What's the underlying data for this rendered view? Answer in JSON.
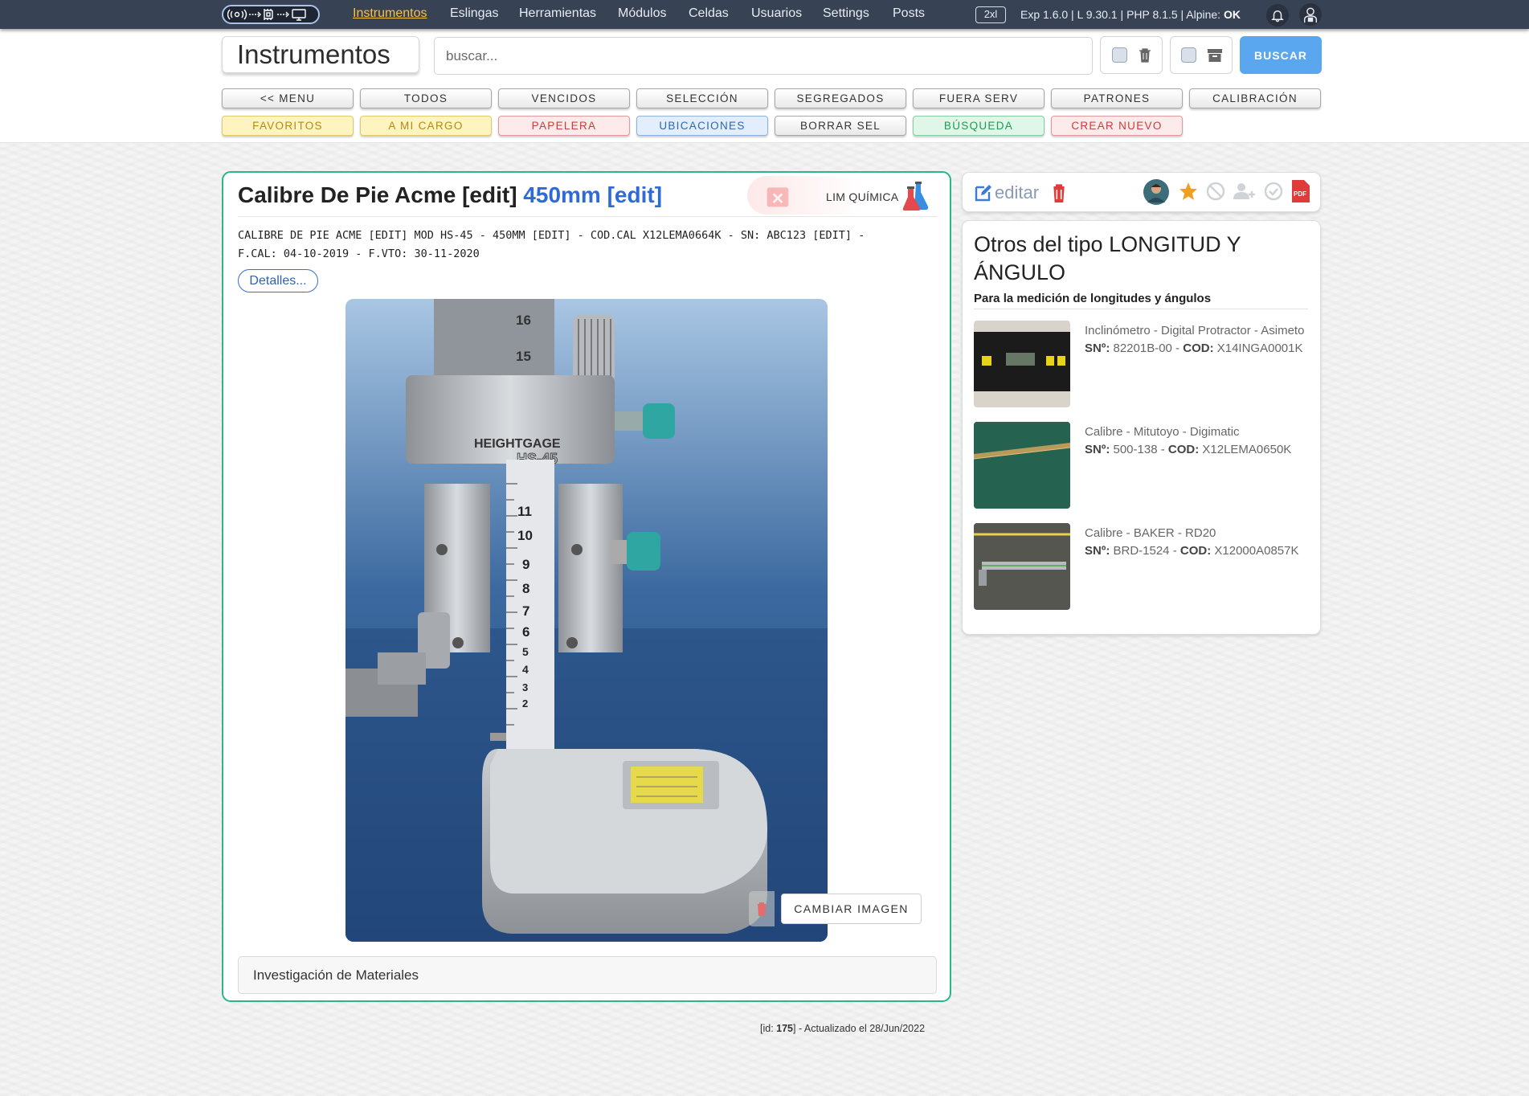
{
  "nav": {
    "items": [
      "Instrumentos",
      "Eslingas",
      "Herramientas",
      "Módulos",
      "Celdas",
      "Usuarios",
      "Settings",
      "Posts"
    ],
    "zoom": "2xl",
    "version_prefix": "Exp 1.6.0 | L 9.30.1 | PHP 8.1.5 | Alpine:",
    "version_status": "OK"
  },
  "header": {
    "title": "Instrumentos",
    "search_placeholder": "buscar...",
    "search_button": "BUSCAR"
  },
  "filters": {
    "row1": [
      "<< MENU",
      "TODOS",
      "VENCIDOS",
      "SELECCIÓN",
      "SEGREGADOS",
      "FUERA SERV",
      "PATRONES",
      "CALIBRACIÓN"
    ],
    "row2": [
      "FAVORITOS",
      "A MI CARGO",
      "PAPELERA",
      "UBICACIONES",
      "BORRAR SEL",
      "BÚSQUEDA",
      "CREAR NUEVO"
    ]
  },
  "instrument": {
    "name": "Calibre De Pie Acme [edit]",
    "range": "450mm [edit]",
    "lab": "LIM QUÍMICA",
    "desc_line1": "CALIBRE DE PIE ACME [EDIT] MOD HS-45 - 450MM [EDIT] - COD.CAL X12LEMA0664K - SN: ABC123 [EDIT] -",
    "desc_line2": "F.CAL: 04-10-2019 - F.VTO: 30-11-2020",
    "details_button": "Detalles...",
    "change_image": "CAMBIAR IMAGEN",
    "location": "Investigación de Materiales",
    "photo": {
      "brand": "HEIGHTGAGE",
      "model": "HS-45"
    }
  },
  "footer": {
    "id_prefix": "[id: ",
    "id": "175",
    "suffix": "] - Actualizado el 28/Jun/2022"
  },
  "actions": {
    "edit": "editar"
  },
  "others": {
    "title": "Otros del tipo LONGITUD Y ÁNGULO",
    "subtitle": "Para la medición de longitudes y ángulos",
    "items": [
      {
        "name": "Inclinómetro - Digital Protractor - Asimeto",
        "sn": "82201B-00",
        "cod": "X14INGA0001K"
      },
      {
        "name": "Calibre - Mitutoyo - Digimatic",
        "sn": "500-138",
        "cod": "X12LEMA0650K"
      },
      {
        "name": "Calibre - BAKER - RD20",
        "sn": "BRD-1524",
        "cod": "X12000A0857K"
      }
    ],
    "sn_label": "SNº:",
    "cod_label": "COD:"
  },
  "colors": {
    "accent": "#2ab58a",
    "primary": "#5ba7ef",
    "nav_bg": "#374254",
    "active_nav": "#f5c242"
  }
}
